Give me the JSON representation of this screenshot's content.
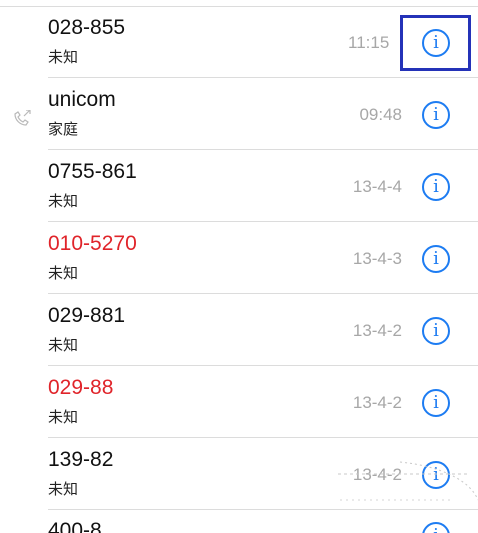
{
  "calls": [
    {
      "name": "028-855",
      "label": "未知",
      "time": "11:15",
      "missed": false,
      "outgoing": false
    },
    {
      "name": "unicom",
      "label": "家庭",
      "time": "09:48",
      "missed": false,
      "outgoing": true
    },
    {
      "name": "0755-861",
      "label": "未知",
      "time": "13-4-4",
      "missed": false,
      "outgoing": false
    },
    {
      "name": "010-5270",
      "label": "未知",
      "time": "13-4-3",
      "missed": true,
      "outgoing": false
    },
    {
      "name": "029-881",
      "label": "未知",
      "time": "13-4-2",
      "missed": false,
      "outgoing": false
    },
    {
      "name": "029-88",
      "label": "未知",
      "time": "13-4-2",
      "missed": true,
      "outgoing": false
    },
    {
      "name": "139-82",
      "label": "未知",
      "time": "13-4-2",
      "missed": false,
      "outgoing": false
    }
  ],
  "partial_call": {
    "name": "400-8"
  },
  "info_glyph": "i",
  "colors": {
    "accent": "#1d7cf2",
    "missed": "#e0242a",
    "time": "#a7a7a7",
    "highlight": "#2432b8"
  }
}
